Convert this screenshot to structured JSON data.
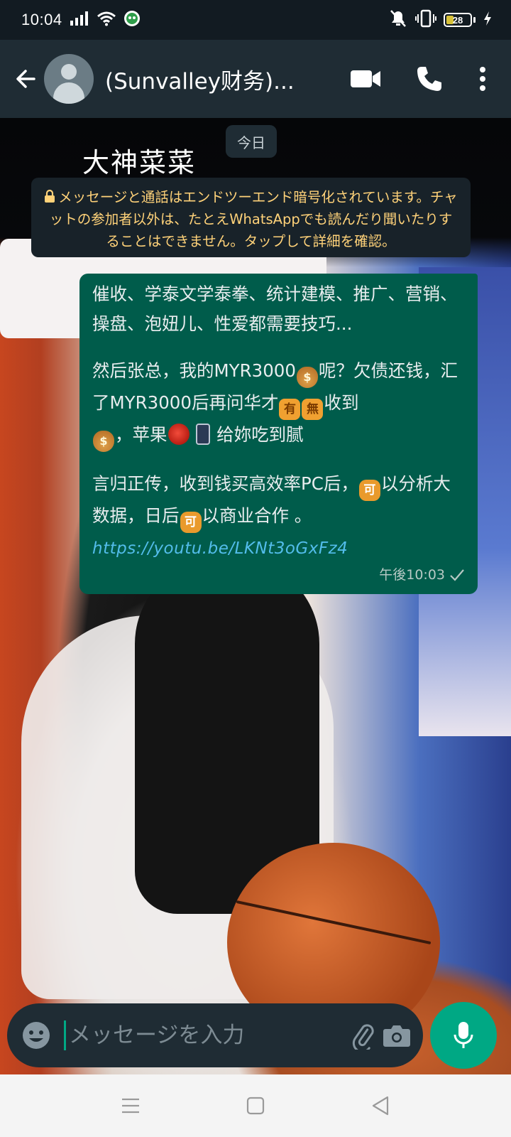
{
  "status_bar": {
    "time": "10:04",
    "battery_level": "28",
    "battery_fraction": 0.28,
    "icons": [
      "signal-icon",
      "wifi-icon",
      "app-notification-icon",
      "vibrate-mute-icon",
      "vibrate-icon",
      "battery-icon",
      "charging-icon"
    ]
  },
  "app_bar": {
    "chat_title": "(Sunvalley财务)...",
    "actions": [
      "back-arrow-icon",
      "video-call-icon",
      "voice-call-icon",
      "more-options-icon"
    ]
  },
  "background": {
    "overlay_title": "大神菜菜"
  },
  "chat": {
    "date_chip": "今日",
    "encryption_notice": "メッセージと通話はエンドツーエンド暗号化されています。チャットの参加者以外は、たとえWhatsAppでも読んだり聞いたりすることはできません。タップして詳細を確認。",
    "message": {
      "line1": "催收、学泰文学泰拳、统计建模、推广、营销、操盘、泡妞儿、性爱都需要技巧...",
      "p2_a": "然后张总，我的MYR3000",
      "p2_b": "呢？欠债还钱，汇了MYR3000后再问华才",
      "p2_e1": "有",
      "p2_e2": "無",
      "p2_c": "收到",
      "p2_d": "，苹果",
      "p2_e": "给妳吃到腻",
      "p3_a": "言归正传，收到钱买高效率PC后，",
      "p3_e1": "可",
      "p3_b": "以分析大数据，日后",
      "p3_e2": "可",
      "p3_c": "以商业合作 。",
      "link": "https://youtu.be/LKNt3oGxFz4",
      "time": "午後10:03",
      "status": "sent"
    }
  },
  "composer": {
    "placeholder": "メッセージを入力",
    "value": ""
  },
  "colors": {
    "accent": "#00a884",
    "outgoing_bubble": "#005c4b",
    "notice_text": "#ffd279",
    "link": "#53bdeb"
  }
}
